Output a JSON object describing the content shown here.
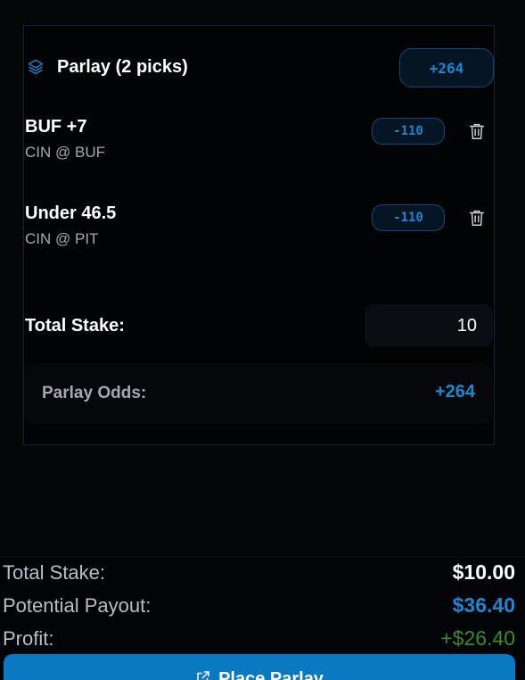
{
  "parlay": {
    "title": "Parlay (2 picks)",
    "odds_badge": "+264",
    "picks": [
      {
        "selection": "BUF +7",
        "matchup": "CIN @ BUF",
        "odds": "-110"
      },
      {
        "selection": "Under 46.5",
        "matchup": "CIN @ PIT",
        "odds": "-110"
      }
    ],
    "stake_label": "Total Stake:",
    "stake_value": "10",
    "odds_label": "Parlay Odds:",
    "odds_value": "+264"
  },
  "summary": {
    "total_stake_label": "Total Stake:",
    "total_stake_value": "$10.00",
    "payout_label": "Potential Payout:",
    "payout_value": "$36.40",
    "profit_label": "Profit:",
    "profit_value": "+$26.40",
    "place_button_label": "Place Parlay"
  },
  "colors": {
    "accent": "#1d87cf",
    "profit": "#3b8a2e",
    "button": "#0a79c2"
  },
  "icons": [
    "layers-icon",
    "trash-icon",
    "external-link-icon"
  ]
}
